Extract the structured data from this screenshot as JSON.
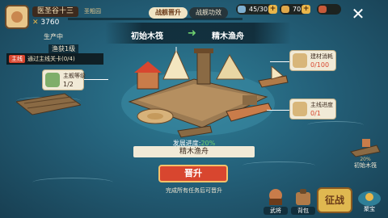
{
  "player": {
    "name": "医圣谷十三",
    "rank": "圣粗园",
    "power": "3760"
  },
  "tabs": [
    {
      "label": "战舰晋升",
      "active": true
    },
    {
      "label": "战舰功效",
      "active": false
    }
  ],
  "resources": [
    {
      "value": "45/30",
      "color": "#7fb0d0"
    },
    {
      "value": "70",
      "color": "#e0a84a"
    },
    {
      "value": "",
      "color": "#c85a3a"
    }
  ],
  "upgrade_header": {
    "from_tier": "初始木筏",
    "to_tier": "精木渔舟",
    "arrow": "➜"
  },
  "left_panel": {
    "status": "生产中",
    "fishing_label": "渔获1级",
    "quest_tag": "主线",
    "quest_text": "通过主线关卡(0/4)"
  },
  "cards": {
    "main_level": {
      "title": "主舰等级",
      "value": "1/2"
    },
    "materials": {
      "title": "建材消耗",
      "value": "0/100"
    },
    "mainline": {
      "title": "主线进度",
      "value": "0/1"
    }
  },
  "progress": {
    "label": "发展进度:",
    "percent": "20%",
    "value": 0.2
  },
  "ship_name": "精木渔舟",
  "upgrade_button": "晋升",
  "upgrade_hint": "完成所有任务后可晋升",
  "corner": {
    "tag": "20%",
    "label": "初始木筏"
  },
  "bottom": {
    "item1": "武将",
    "item2": "背包",
    "battle": "征战",
    "reward": "聚宝"
  },
  "colors": {
    "accent_red": "#d8462f",
    "card_bg": "#f1ead7",
    "ok_green": "#6fd06f"
  }
}
